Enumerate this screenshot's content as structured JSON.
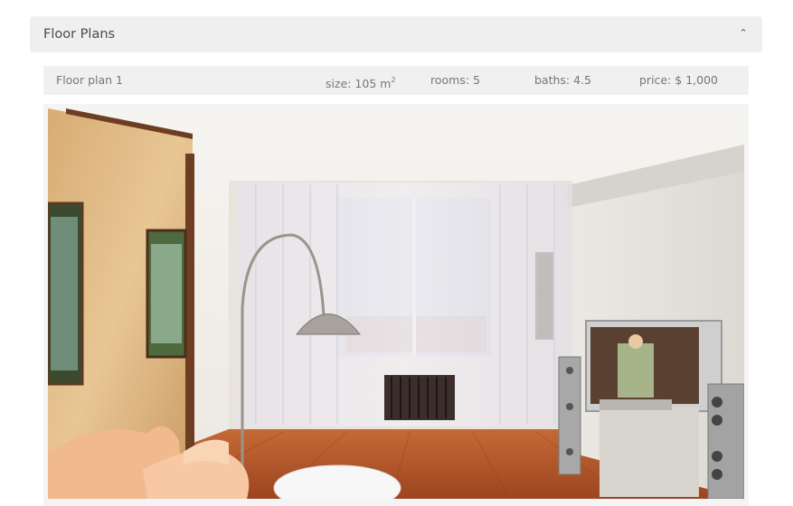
{
  "accordion": {
    "title": "Floor Plans",
    "toggle_icon": "chevron-up-icon"
  },
  "floor_plan": {
    "name": "Floor plan 1",
    "size_label": "size: 105 m",
    "size_unit_sup": "2",
    "rooms_label": "rooms: 5",
    "baths_label": "baths: 4.5",
    "price_label": "price: $ 1,000"
  },
  "photo": {
    "subject": "living-room-interior",
    "colors": {
      "floor": "#b5572a",
      "wall": "#e9e4dc",
      "curtain": "#eeeaf0",
      "accent_wall": "#d9b07a"
    }
  }
}
